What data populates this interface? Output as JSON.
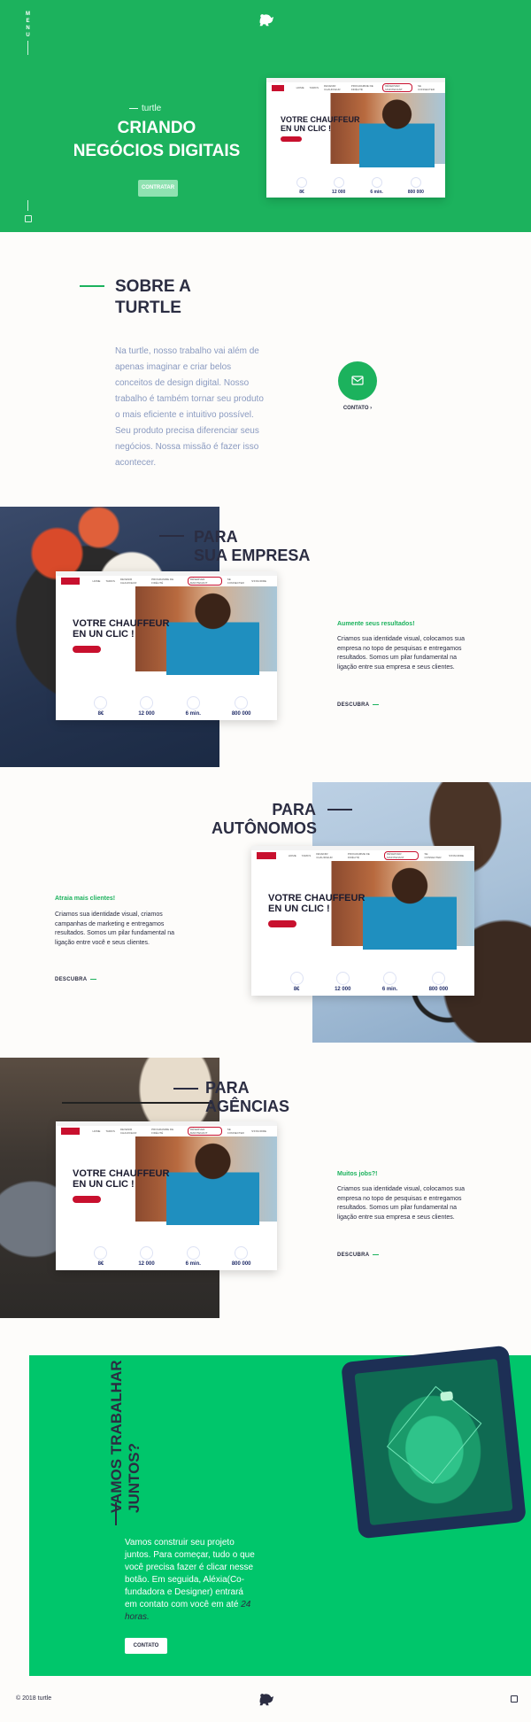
{
  "nav": {
    "menu_label": "MENU"
  },
  "hero": {
    "kicker": "turtle",
    "title_line1": "CRIANDO",
    "title_line2": "NEGÓCIOS DIGITAIS",
    "button_label": "CONTRATAR"
  },
  "mockup": {
    "nav_items": [
      "HOME",
      "TARIFS",
      "DEVENIR CHAUFFEUR",
      "PROGRAMME DE FIDÉLITÉ",
      "RÉSERVER MAINTENANT",
      "SE CONNECTER",
      "S'INSCRIRE"
    ],
    "headline_line1": "VOTRE CHAUFFEUR",
    "headline_line2": "EN UN CLIC !",
    "stats": [
      {
        "value": "8€",
        "icon": "tag-icon"
      },
      {
        "value": "12 000",
        "icon": "car-icon"
      },
      {
        "value": "6 min.",
        "icon": "clock-icon"
      },
      {
        "value": "800 000",
        "icon": "user-icon"
      }
    ]
  },
  "about": {
    "title_line1": "SOBRE A",
    "title_line2": "TURTLE",
    "text": "Na turtle, nosso trabalho vai além de apenas imaginar e criar belos conceitos de design digital. Nosso trabalho é também tornar seu produto o mais eficiente e intuitivo possível. Seu produto precisa diferenciar seus negócios. Nossa missão é fazer isso acontecer.",
    "contact_label": "CONTATO"
  },
  "sections": [
    {
      "title_line1": "PARA",
      "title_line2": "SUA EMPRESA",
      "subtitle": "Aumente seus resultados!",
      "text": "Criamos sua identidade visual, colocamos sua empresa no topo de pesquisas e entregamos resultados. Somos um pilar fundamental na ligação entre sua empresa e seus clientes.",
      "link": "DESCUBRA"
    },
    {
      "title_line1": "PARA",
      "title_line2": "AUTÔNOMOS",
      "subtitle": "Atraia mais clientes!",
      "text": "Criamos sua identidade visual, criamos campanhas de marketing e entregamos resultados. Somos um pilar fundamental na ligação entre você e seus clientes.",
      "link": "DESCUBRA"
    },
    {
      "title_line1": "PARA",
      "title_line2": "AGÊNCIAS",
      "subtitle": "Muitos jobs?!",
      "text": "Criamos sua identidade visual, colocamos sua empresa no topo de pesquisas e entregamos resultados. Somos um pilar fundamental na ligação entre sua empresa e seus clientes.",
      "link": "DESCUBRA"
    }
  ],
  "cta": {
    "vertical_title": "VAMOS TRABALHAR JUNTOS?",
    "text_main": "Vamos construir seu projeto juntos. Para começar, tudo o que você precisa fazer é clicar nesse botão. Em seguida, Aléxia(Co-fundadora e Designer) entrará em contato com você em até",
    "text_em": "24 horas.",
    "button_label": "CONTATO"
  },
  "footer": {
    "copyright": "© 2018 turtle"
  },
  "colors": {
    "brand_green": "#1cb25d",
    "cta_green": "#00c66b",
    "navy": "#2b2d42",
    "accent_red": "#c8102e"
  }
}
